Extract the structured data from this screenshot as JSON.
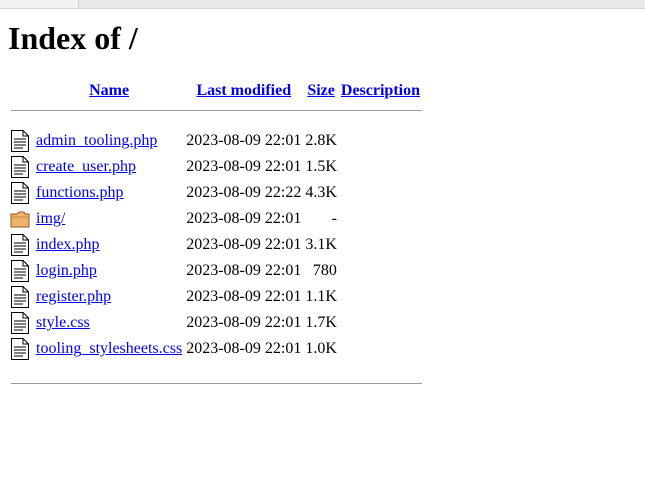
{
  "page": {
    "title": "Index of /"
  },
  "table": {
    "headers": {
      "name": "Name",
      "last_modified": "Last modified",
      "size": "Size",
      "description": "Description"
    },
    "rows": [
      {
        "icon": "text-file-icon",
        "name": "admin_tooling.php",
        "modified": "2023-08-09 22:01",
        "size": "2.8K",
        "description": ""
      },
      {
        "icon": "text-file-icon",
        "name": "create_user.php",
        "modified": "2023-08-09 22:01",
        "size": "1.5K",
        "description": ""
      },
      {
        "icon": "text-file-icon",
        "name": "functions.php",
        "modified": "2023-08-09 22:22",
        "size": "4.3K",
        "description": ""
      },
      {
        "icon": "folder-icon",
        "name": "img/",
        "modified": "2023-08-09 22:01",
        "size": "-",
        "description": ""
      },
      {
        "icon": "text-file-icon",
        "name": "index.php",
        "modified": "2023-08-09 22:01",
        "size": "3.1K",
        "description": ""
      },
      {
        "icon": "text-file-icon",
        "name": "login.php",
        "modified": "2023-08-09 22:01",
        "size": "780",
        "description": ""
      },
      {
        "icon": "text-file-icon",
        "name": "register.php",
        "modified": "2023-08-09 22:01",
        "size": "1.1K",
        "description": ""
      },
      {
        "icon": "text-file-icon",
        "name": "style.css",
        "modified": "2023-08-09 22:01",
        "size": "1.7K",
        "description": ""
      },
      {
        "icon": "text-file-icon",
        "name": "tooling_stylesheets.css",
        "modified": "2023-08-09 22:01",
        "size": "1.0K",
        "description": ""
      }
    ]
  },
  "colors": {
    "link": "#0000ee",
    "rule": "#9a9a9a",
    "folder": "#f0b26a"
  }
}
